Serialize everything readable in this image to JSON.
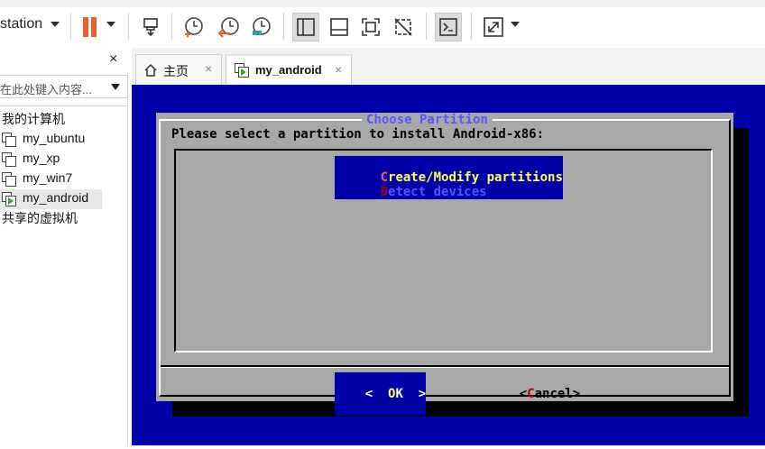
{
  "toolbar": {
    "app_title": "station",
    "icons": [
      "pause-icon",
      "send-keys-icon",
      "snapshot-icon",
      "revert-snapshot-icon",
      "snapshot-manager-icon",
      "show-library-icon",
      "thumbnail-bar-icon",
      "fullscreen-icon",
      "unity-icon",
      "console-icon",
      "stretch-icon"
    ]
  },
  "sidebar": {
    "close_label": "×",
    "search_placeholder": "在此处键入内容...",
    "tree": {
      "root": "我的计算机",
      "vms": [
        "my_ubuntu",
        "my_xp",
        "my_win7",
        "my_android"
      ],
      "shared": "共享的虚拟机"
    }
  },
  "tabs": [
    {
      "label": "主页",
      "close": "×",
      "icon": "home-icon"
    },
    {
      "label": "my_android",
      "close": "×",
      "icon": "vm-running-icon"
    }
  ],
  "vm": {
    "dialog_title": "Choose Partition",
    "prompt": "Please select a partition to install Android-x86:",
    "options": [
      {
        "hotkey": "C",
        "rest": "reate/Modify partitions",
        "selected": true
      },
      {
        "hotkey": "D",
        "rest": "etect devices",
        "selected": false
      }
    ],
    "ok_button": {
      "left": "<  ",
      "hotkey": "O",
      "rest": "K  >"
    },
    "cancel_button": {
      "left": "<",
      "hotkey": "C",
      "rest": "ancel>"
    }
  },
  "colors": {
    "vm_background": "#0000a8",
    "dialog_gray": "#a8a8a8",
    "highlight_yellow": "#ffff55",
    "hotkey_red": "#a80000",
    "pause_orange": "#e8612c",
    "running_green": "#2fa52f"
  }
}
